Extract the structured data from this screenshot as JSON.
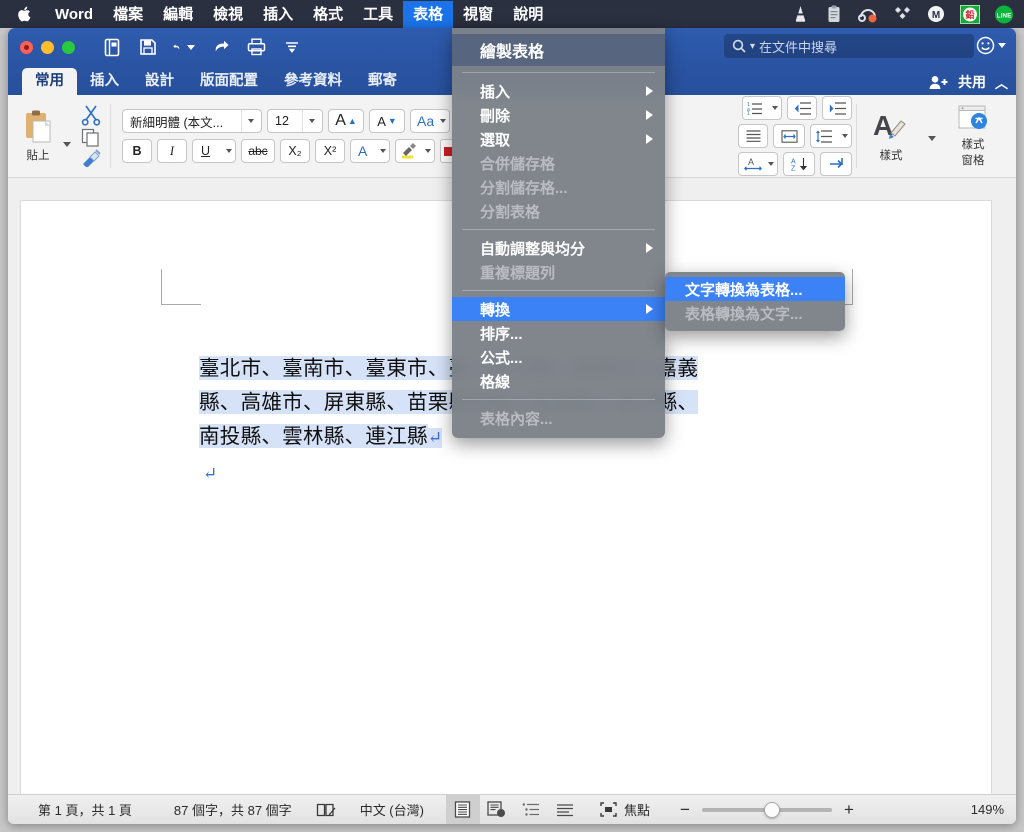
{
  "macbar": {
    "apple_icon": "apple-logo",
    "items": [
      {
        "label": "Word",
        "bold": true,
        "active": false
      },
      {
        "label": "檔案",
        "bold": true,
        "active": false
      },
      {
        "label": "編輯",
        "bold": true,
        "active": false
      },
      {
        "label": "檢視",
        "bold": true,
        "active": false
      },
      {
        "label": "插入",
        "bold": true,
        "active": false
      },
      {
        "label": "格式",
        "bold": true,
        "active": false
      },
      {
        "label": "工具",
        "bold": true,
        "active": false
      },
      {
        "label": "表格",
        "bold": true,
        "active": true
      },
      {
        "label": "視窗",
        "bold": true,
        "active": false
      },
      {
        "label": "說明",
        "bold": true,
        "active": false
      }
    ],
    "tray": [
      "vlc-cone-icon",
      "clipboard-icon",
      "headphones-icon",
      "diamonds-icon",
      "m-circle-icon",
      "seal-icon",
      "line-icon"
    ]
  },
  "titlebar": {
    "quick_access": [
      "document-properties-icon",
      "save-icon",
      "undo-icon",
      "redo-icon",
      "print-icon",
      "customize-icon"
    ],
    "search": {
      "placeholder": "在文件中搜尋",
      "icon": "search-icon"
    },
    "smiley_icon": "smiley-feedback-icon"
  },
  "tabs": {
    "items": [
      {
        "label": "常用",
        "selected": true
      },
      {
        "label": "插入",
        "selected": false
      },
      {
        "label": "設計",
        "selected": false
      },
      {
        "label": "版面配置",
        "selected": false
      },
      {
        "label": "參考資料",
        "selected": false
      },
      {
        "label": "郵寄",
        "selected": false
      }
    ],
    "share_label": "共用",
    "share_icon": "person-plus-icon",
    "collapse_icon": "chevron-up-icon"
  },
  "ribbon": {
    "clipboard": {
      "paste_label": "貼上",
      "paste_icon": "clipboard-paste-icon",
      "cut_icon": "scissors-icon",
      "copy_icon": "copy-icon",
      "format_painter_icon": "paintbrush-icon"
    },
    "font": {
      "family": "新細明體 (本文...",
      "size": "12",
      "grow_label": "A",
      "shrink_label": "A",
      "case_label": "Aa",
      "bold_label": "B",
      "italic_label": "I",
      "underline_label": "U",
      "strike_label": "abc",
      "subscript_label": "X₂",
      "superscript_label": "X²",
      "text_effects_label": "A",
      "highlight_icon": "highlighter-icon",
      "font_color_icon": "font-color-icon"
    },
    "paragraph": {
      "numbered_list_icon": "numbered-list-icon",
      "decrease_indent_icon": "decrease-indent-icon",
      "increase_indent_icon": "increase-indent-icon",
      "justify_icon": "justify-icon",
      "cjk_spacing_icon": "cjk-spacing-icon",
      "line_spacing_icon": "line-spacing-icon",
      "char_spacing_icon": "char-spacing-icon",
      "sort_icon": "sort-az-icon",
      "show_marks_icon": "show-paragraph-marks-icon"
    },
    "styles": {
      "styles_label": "樣式",
      "styles_icon": "styles-brush-icon",
      "styles_pane_label": "樣式\n窗格",
      "styles_pane_line1": "樣式",
      "styles_pane_line2": "窗格",
      "styles_pane_icon": "styles-pane-icon"
    }
  },
  "table_menu": {
    "header": {
      "label": "繪製表格",
      "enabled": true
    },
    "groups": [
      [
        {
          "label": "插入",
          "submenu": true,
          "enabled": true
        },
        {
          "label": "刪除",
          "submenu": true,
          "enabled": true
        },
        {
          "label": "選取",
          "submenu": true,
          "enabled": true
        },
        {
          "label": "合併儲存格",
          "submenu": false,
          "enabled": false
        },
        {
          "label": "分割儲存格...",
          "submenu": false,
          "enabled": false
        },
        {
          "label": "分割表格",
          "submenu": false,
          "enabled": false
        }
      ],
      [
        {
          "label": "自動調整與均分",
          "submenu": true,
          "enabled": true
        },
        {
          "label": "重複標題列",
          "submenu": false,
          "enabled": false
        }
      ],
      [
        {
          "label": "轉換",
          "submenu": true,
          "enabled": true,
          "highlighted": true
        },
        {
          "label": "排序...",
          "submenu": false,
          "enabled": true
        },
        {
          "label": "公式...",
          "submenu": false,
          "enabled": true
        },
        {
          "label": "格線",
          "submenu": false,
          "enabled": true
        }
      ],
      [
        {
          "label": "表格內容...",
          "submenu": false,
          "enabled": false
        }
      ]
    ]
  },
  "convert_submenu": {
    "items": [
      {
        "label": "文字轉換為表格...",
        "enabled": true,
        "highlighted": true
      },
      {
        "label": "表格轉換為文字...",
        "enabled": false,
        "highlighted": false
      }
    ]
  },
  "document": {
    "lines": [
      {
        "left": "臺北市、臺南市、臺東市、臺",
        "right": "、新竹縣、嘉義市、嘉義"
      },
      {
        "left": "縣、高雄市、屏東縣、苗栗縣",
        "right": "化縣、澎湖縣、金門縣、"
      },
      {
        "left": "南投縣、雲林縣、連江縣",
        "right": ""
      }
    ],
    "paragraph_mark": "↵",
    "trailing_mark": "↵"
  },
  "status": {
    "page_info": "第 1 頁，共 1 頁",
    "word_count": "87 個字，共 87 個字",
    "proofing_icon": "proofing-icon",
    "language": "中文 (台灣)",
    "view_buttons": [
      {
        "icon": "print-layout-view-icon",
        "active": true
      },
      {
        "icon": "web-layout-view-icon",
        "active": false
      },
      {
        "icon": "outline-view-icon",
        "active": false
      },
      {
        "icon": "draft-view-icon",
        "active": false
      }
    ],
    "focus_label": "焦點",
    "focus_icon": "focus-mode-icon",
    "zoom_out_label": "−",
    "zoom_in_label": "+",
    "zoom_value": "149%"
  },
  "colors": {
    "accent_blue": "#1a73e8",
    "titlebar_blue": "#2a54a3",
    "menu_highlight": "#3b82f6",
    "selection": "#d6e2f7",
    "macbar_bg": "#2b3040"
  }
}
